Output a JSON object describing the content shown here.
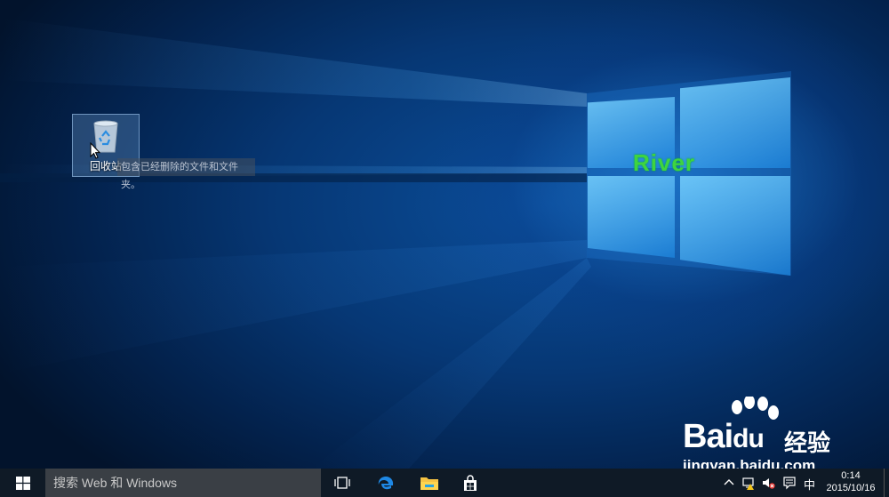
{
  "desktop": {
    "icons": [
      {
        "label": "回收站",
        "tooltip": "包含已经删除的文件和文件夹。"
      }
    ],
    "watermark": "River"
  },
  "overlay": {
    "logo_text": "Bai",
    "logo_du": "du",
    "logo_cn": "经验",
    "url": "jingyan.baidu.com"
  },
  "taskbar": {
    "search_placeholder": "搜索 Web 和 Windows",
    "pinned": [
      "task-view-icon",
      "edge-icon",
      "file-explorer-icon",
      "store-icon"
    ],
    "tray": {
      "ime": "中",
      "time": "0:14",
      "date": "2015/10/16"
    }
  },
  "colors": {
    "accent": "#0b4f9c",
    "taskbar": "#0f1a26",
    "watermark": "#3fd43f"
  }
}
